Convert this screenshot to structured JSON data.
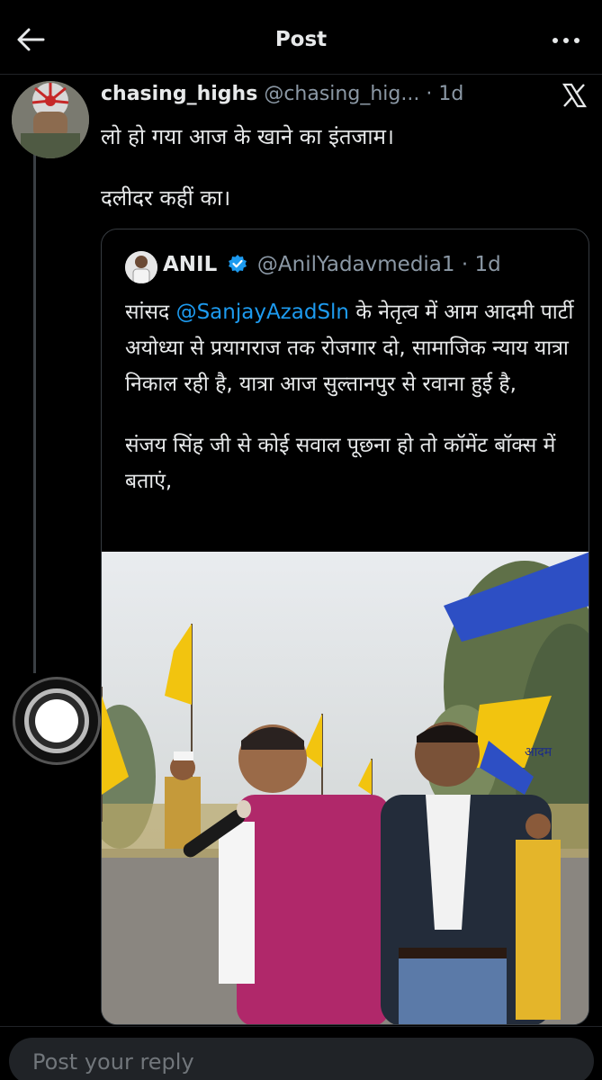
{
  "header": {
    "title": "Post",
    "back_icon": "arrow-left-icon",
    "more_icon": "more-dots-icon"
  },
  "tweet": {
    "author_name": "chasing_highs",
    "author_handle": "@chasing_hig...",
    "time": "1d",
    "text_line1": "लो हो गया आज के खाने का इंतजाम।",
    "text_line2": "दलीदर कहीं का।"
  },
  "quote": {
    "author_name": "ANIL",
    "author_handle": "@AnilYadavmedia1",
    "time": "1d",
    "verified": true,
    "text_prefix": "सांसद ",
    "mention": "@SanjayAzadSln",
    "text_after_mention": " के नेतृत्व में आम आदमी पार्टी अयोध्या से प्रयागराज तक रोजगार दो, सामाजिक न्याय यात्रा निकाल रही है, यात्रा आज सुल्तानपुर से रवाना हुई है,",
    "text_para2": "संजय सिंह जी से कोई सवाल पूछना हो तो कॉमेंट बॉक्स में बताएं,",
    "photo_flag_text": "आदम"
  },
  "reply": {
    "placeholder": "Post your reply"
  },
  "colors": {
    "background": "#000000",
    "text": "#e7e9ea",
    "secondary": "#8b98a5",
    "accent": "#1d9bf0",
    "flag_yellow": "#f2c40f",
    "flag_blue": "#2d4fc4"
  }
}
